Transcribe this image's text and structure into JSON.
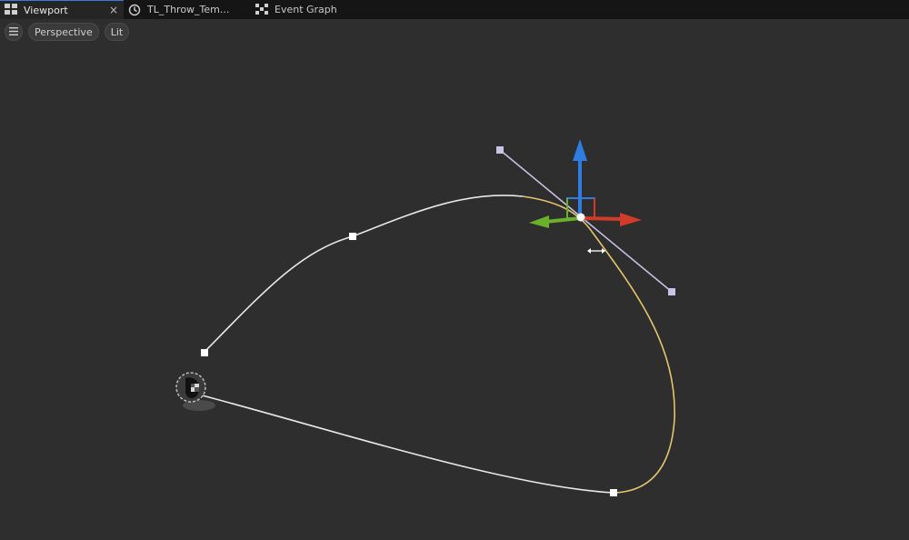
{
  "tabs": [
    {
      "label": "Viewport",
      "icon": "viewport-icon",
      "active": true,
      "close": "×"
    },
    {
      "label": "TL_Throw_Tem...",
      "icon": "clock-icon",
      "active": false
    },
    {
      "label": "Event Graph",
      "icon": "graph-icon",
      "active": false
    }
  ],
  "toolbar": {
    "menu_icon": "hamburger-icon",
    "perspective_label": "Perspective",
    "lit_label": "Lit"
  },
  "colors": {
    "background": "#2e2e2e",
    "tabbar": "#151515",
    "spline": "#e8e8e8",
    "spline_selected": "#e3c56e",
    "tangent": "#c9c3e6",
    "gizmo_z": "#2f7de1",
    "gizmo_x": "#d23a2a",
    "gizmo_y": "#6ab02a"
  }
}
